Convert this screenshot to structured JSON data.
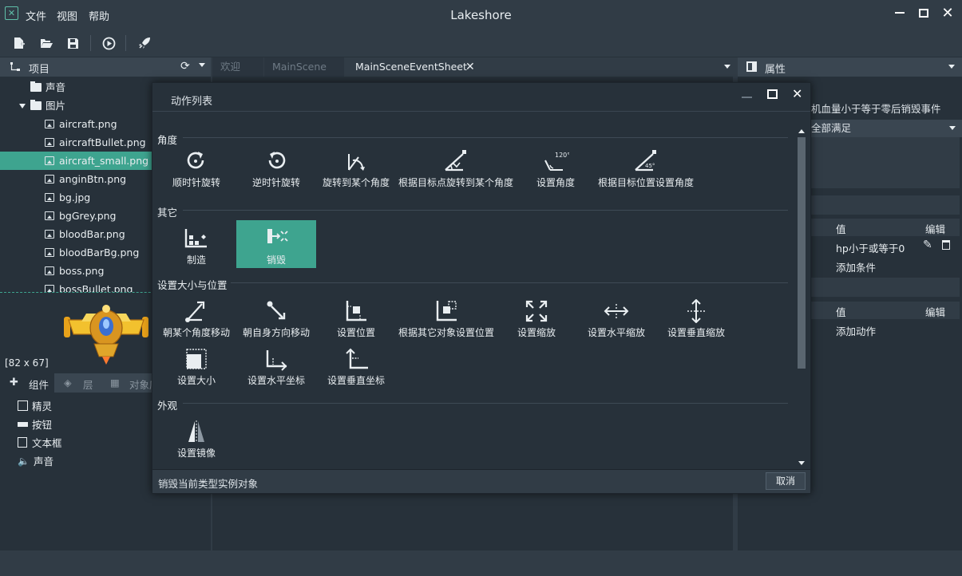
{
  "app": {
    "title": "Lakeshore"
  },
  "menu": [
    "文件",
    "视图",
    "帮助"
  ],
  "project_panel": {
    "title": "项目",
    "tree": [
      {
        "label": "声音",
        "type": "folder"
      },
      {
        "label": "图片",
        "type": "folder-open"
      },
      {
        "label": "aircraft.png",
        "type": "image"
      },
      {
        "label": "aircraftBullet.png",
        "type": "image"
      },
      {
        "label": "aircraft_small.png",
        "type": "image",
        "selected": true
      },
      {
        "label": "anginBtn.png",
        "type": "image"
      },
      {
        "label": "bg.jpg",
        "type": "image"
      },
      {
        "label": "bgGrey.png",
        "type": "image"
      },
      {
        "label": "bloodBar.png",
        "type": "image"
      },
      {
        "label": "bloodBarBg.png",
        "type": "image"
      },
      {
        "label": "boss.png",
        "type": "image"
      },
      {
        "label": "bossBullet.png",
        "type": "image"
      }
    ],
    "preview_size": "[82 x 67]"
  },
  "components_panel": {
    "tabs": [
      "组件",
      "层",
      "对象库"
    ],
    "items": [
      "精灵",
      "按钮",
      "文本框",
      "声音"
    ]
  },
  "editor_tabs": [
    "欢迎",
    "MainScene",
    "MainSceneEventSheet"
  ],
  "properties_panel": {
    "title": "属性",
    "event_name": "机血量小于等于零后销毁事件",
    "condition_mode": "全部满足",
    "conditions_header": {
      "value": "值",
      "edit": "编辑"
    },
    "condition_row": "hp小于或等于0",
    "add_condition": "添加条件",
    "actions_header": {
      "value": "值",
      "edit": "编辑"
    },
    "add_action": "添加动作"
  },
  "dialog": {
    "title": "动作列表",
    "sections": [
      {
        "name": "角度",
        "actions": [
          {
            "label": "顺时针旋转",
            "icon": "rotate-cw-icon"
          },
          {
            "label": "逆时针旋转",
            "icon": "rotate-ccw-icon"
          },
          {
            "label": "旋转到某个角度",
            "icon": "rotate-to-angle-icon"
          },
          {
            "label": "根据目标点旋转到某个角度",
            "icon": "rotate-to-point-icon"
          },
          {
            "label": "设置角度",
            "icon": "set-angle-icon"
          },
          {
            "label": "根据目标位置设置角度",
            "icon": "set-angle-target-icon"
          }
        ]
      },
      {
        "name": "其它",
        "actions": [
          {
            "label": "制造",
            "icon": "factory-icon"
          },
          {
            "label": "销毁",
            "icon": "destroy-icon",
            "selected": true
          }
        ]
      },
      {
        "name": "设置大小与位置",
        "actions": [
          {
            "label": "朝某个角度移动",
            "icon": "move-angle-icon"
          },
          {
            "label": "朝自身方向移动",
            "icon": "move-forward-icon"
          },
          {
            "label": "设置位置",
            "icon": "set-position-icon"
          },
          {
            "label": "根据其它对象设置位置",
            "icon": "position-object-icon"
          },
          {
            "label": "设置缩放",
            "icon": "scale-icon"
          },
          {
            "label": "设置水平缩放",
            "icon": "scale-x-icon"
          },
          {
            "label": "设置垂直缩放",
            "icon": "scale-y-icon"
          },
          {
            "label": "设置大小",
            "icon": "set-size-icon"
          },
          {
            "label": "设置水平坐标",
            "icon": "set-x-icon"
          },
          {
            "label": "设置垂直坐标",
            "icon": "set-y-icon"
          }
        ]
      },
      {
        "name": "外观",
        "actions": [
          {
            "label": "设置镜像",
            "icon": "mirror-icon"
          }
        ]
      }
    ],
    "description": "销毁当前类型实例对象",
    "cancel": "取消"
  },
  "colors": {
    "accent": "#3ea48f",
    "panel": "#27313a",
    "chrome": "#313c46"
  }
}
